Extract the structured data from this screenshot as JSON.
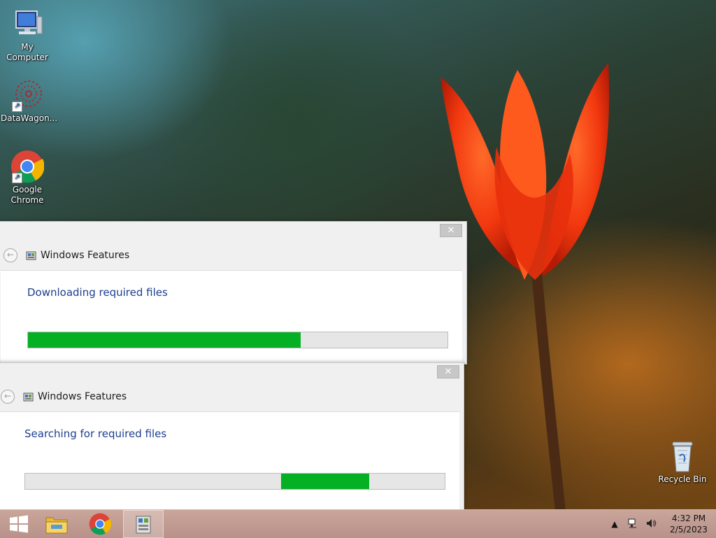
{
  "desktop": {
    "icons": [
      {
        "label": "My Computer",
        "icon": "computer-icon"
      },
      {
        "label": "DataWagon...",
        "icon": "datawagon-icon"
      },
      {
        "label": "Google Chrome",
        "icon": "chrome-icon"
      }
    ],
    "recycle_bin": {
      "label": "Recycle Bin",
      "icon": "recycle-bin-icon"
    }
  },
  "dialogs": [
    {
      "title": "Windows Features",
      "close_label": "✕",
      "status": "Downloading required files",
      "progress": {
        "fill_start": 0.0,
        "fill_end": 0.65
      }
    },
    {
      "title": "Windows Features",
      "close_label": "✕",
      "status": "Searching for required files",
      "progress": {
        "fill_start": 0.61,
        "fill_end": 0.82,
        "indeterminate": true
      }
    }
  ],
  "taskbar": {
    "buttons": [
      "start-icon",
      "file-explorer-icon",
      "chrome-icon",
      "windows-features-icon"
    ],
    "active": "windows-features-icon",
    "tray_icons": [
      "show-hidden-icons-icon",
      "network-icon",
      "volume-icon"
    ],
    "time": "4:32 PM",
    "date": "2/5/2023"
  },
  "colors": {
    "progress_fill": "#06b025",
    "status_text": "#1c3f8f",
    "taskbar": "#c0998f"
  }
}
